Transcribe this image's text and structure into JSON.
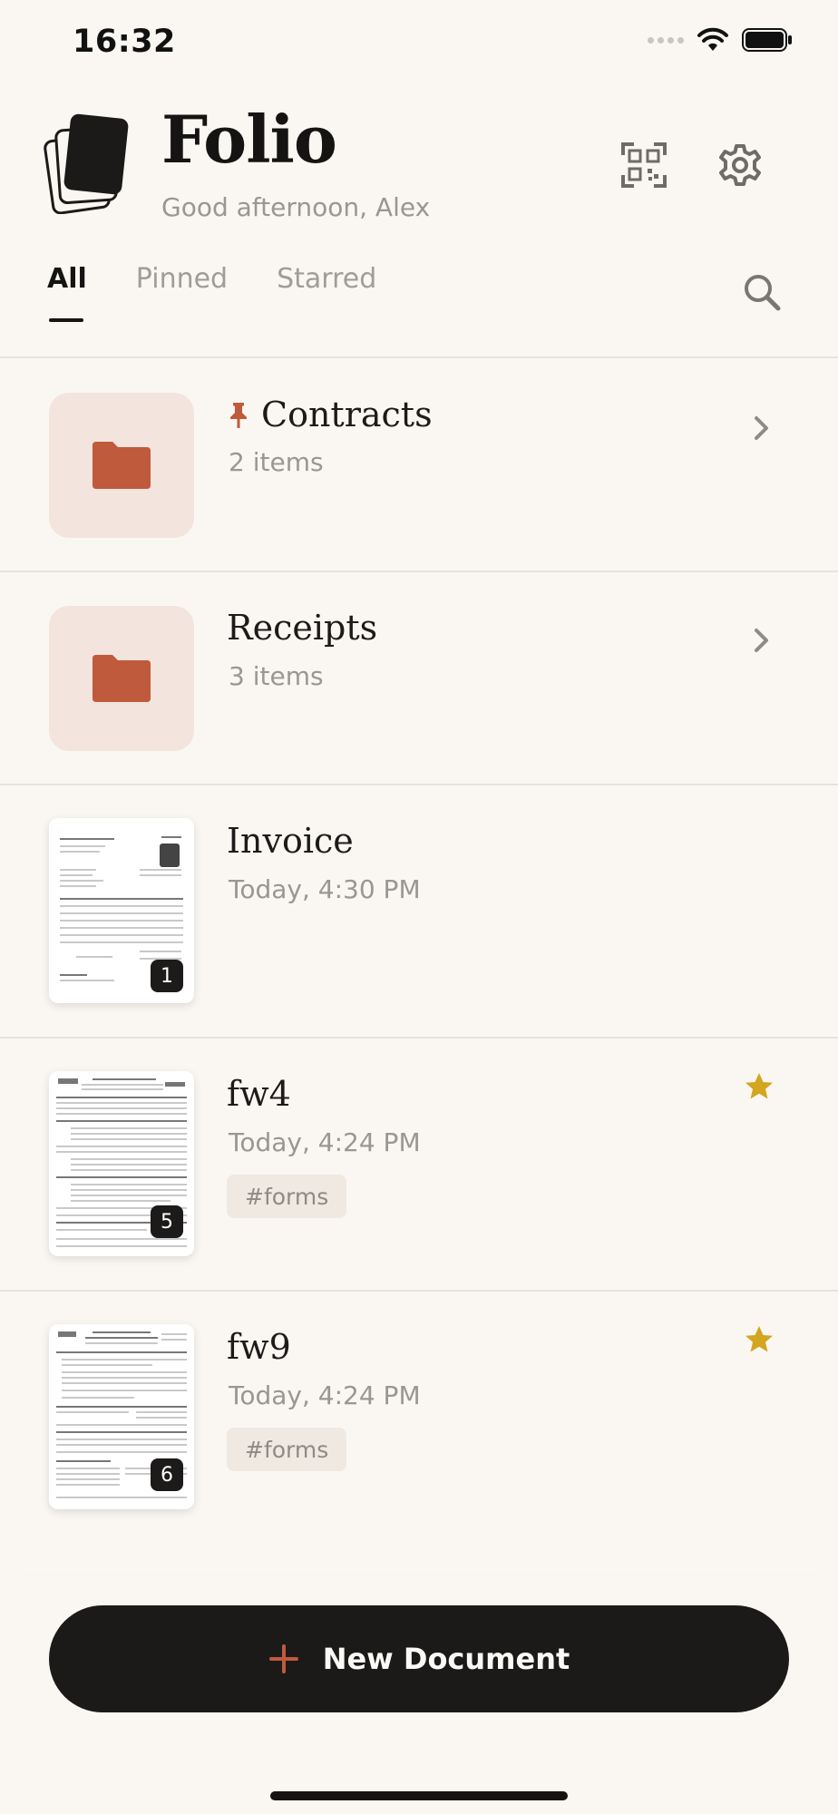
{
  "status": {
    "time": "16:32"
  },
  "header": {
    "title": "Folio",
    "greeting": "Good afternoon, Alex"
  },
  "tabs": [
    {
      "label": "All",
      "active": true
    },
    {
      "label": "Pinned",
      "active": false
    },
    {
      "label": "Starred",
      "active": false
    }
  ],
  "items": [
    {
      "kind": "folder",
      "title": "Contracts",
      "subtitle": "2 items",
      "pinned": true
    },
    {
      "kind": "folder",
      "title": "Receipts",
      "subtitle": "3 items",
      "pinned": false
    },
    {
      "kind": "document",
      "title": "Invoice",
      "subtitle": "Today, 4:30 PM",
      "pages": "1",
      "starred": false
    },
    {
      "kind": "document",
      "title": "fw4",
      "subtitle": "Today, 4:24 PM",
      "pages": "5",
      "starred": true,
      "tag": "#forms"
    },
    {
      "kind": "document",
      "title": "fw9",
      "subtitle": "Today, 4:24 PM",
      "pages": "6",
      "starred": true,
      "tag": "#forms"
    }
  ],
  "actions": {
    "new_document": "New Document",
    "new_document_icon": "+"
  },
  "colors": {
    "accent": "#c05a3c",
    "star": "#d4a51f",
    "background": "#faf7f2",
    "button": "#1b1a19"
  }
}
